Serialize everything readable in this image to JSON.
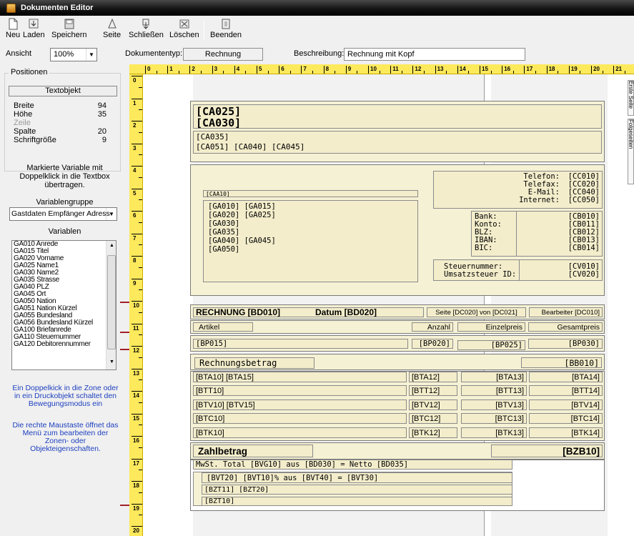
{
  "window": {
    "title": "Dokumenten Editor"
  },
  "toolbar": {
    "neu": "Neu",
    "laden": "Laden",
    "speichern": "Speichern",
    "seite": "Seite",
    "schliessen": "Schließen",
    "loeschen": "Löschen",
    "beenden": "Beenden"
  },
  "options": {
    "ansicht_label": "Ansicht",
    "zoom": "100%",
    "doctype_label": "Dokumententyp:",
    "doctype": "Rechnung",
    "beschreibung_label": "Beschreibung:",
    "beschreibung": "Rechnung mit Kopf"
  },
  "left_panel": {
    "positions_title": "Positionen",
    "object_type": "Textobjekt",
    "props": [
      {
        "label": "Breite",
        "value": "94"
      },
      {
        "label": "Höhe",
        "value": "35"
      },
      {
        "label": "Zeile",
        "value": ""
      },
      {
        "label": "Spalte",
        "value": "20"
      },
      {
        "label": "Schriftgröße",
        "value": "9"
      }
    ],
    "hint1": [
      "Markierte Variable mit",
      "Doppelklick in die Textbox",
      "übertragen."
    ],
    "group_label": "Variablengruppe",
    "group_value": "Gastdaten Empfänger Adress",
    "vars_label": "Variablen",
    "variables": [
      "GA010 Anrede",
      "GA015 Titel",
      "GA020 Vorname",
      "GA025 Name1",
      "GA030 Name2",
      "GA035 Strasse",
      "GA040 PLZ",
      "GA045 Ort",
      "GA050 Nation",
      "GA051 Nation Kürzel",
      "GA055 Bundesland",
      "GA056 Bundesland Kürzel",
      "GA100 Briefanrede",
      "GA110 Steuernummer",
      "GA120 Debitorennummer"
    ],
    "hint2": [
      "Ein Doppelkick in die Zone oder",
      "in ein Druckobjekt schaltet den",
      "Bewegungsmodus ein"
    ],
    "hint3": [
      "Die rechte Maustaste öffnet das",
      "Menü zum bearbeiten der",
      "Zonen- oder",
      "Objekteigenschaften."
    ]
  },
  "ruler": {
    "top": [
      "0",
      "1",
      "2",
      "3",
      "4",
      "5",
      "6",
      "7",
      "8",
      "9",
      "10",
      "11",
      "12",
      "13",
      "14",
      "15",
      "16",
      "17",
      "18",
      "19",
      "20",
      "21"
    ],
    "left": [
      "0",
      "1",
      "2",
      "3",
      "4",
      "5",
      "6",
      "7",
      "8",
      "9",
      "10",
      "11",
      "12",
      "13",
      "14",
      "15",
      "16",
      "17",
      "18",
      "19",
      "20"
    ]
  },
  "side_tabs": [
    "Erste Seite",
    "Folgeseiten"
  ],
  "doc": {
    "h1": "[CA025]",
    "h2": "[CA030]",
    "h3": "[CA035]",
    "h4": "[CA051] [CA040] [CA045]",
    "contact_labels": "Telefon:\nTelefax:\nE-Mail:\nInternet:",
    "contact_vals": "[CC010]\n[CC020]\n[CC040]\n[CC050]",
    "bank_labels": "Bank:\nKonto:\nBLZ:\nIBAN:\nBIC:",
    "bank_vals": "[CB010]\n[CB011]\n[CB012]\n[CB013]\n[CB014]",
    "tax_labels": "Steuernummer:\nUmsatzsteuer ID:",
    "tax_vals": "[CV010]\n[CV020]",
    "addr_head": "[CAA10]",
    "addr_lines": "[GA010] [GA015]\n[GA020] [GA025]\n[GA030]\n[GA035]\n[GA040] [GA045]\n[GA050]",
    "rechnung": "RECHNUNG [BD010]",
    "datum": "Datum [BD020]",
    "seite": "Seite [DC020] von [DC021]",
    "bearbeiter": "Bearbeiter [DC010]",
    "col_artikel": "Artikel",
    "col_anzahl": "Anzahl",
    "col_einzel": "Einzelpreis",
    "col_gesamt": "Gesamtpreis",
    "bp015": "[BP015]",
    "bp020": "[BP020]",
    "bp025": "[BP025]",
    "bp030": "[BP030]",
    "rb_label": "Rechnungsbetrag",
    "rb_val": "[BB010]",
    "rows": [
      [
        "[BTA10] [BTA15]",
        "[BTA12]",
        "[BTA13]",
        "[BTA14]"
      ],
      [
        "[BTT10]",
        "[BTT12]",
        "[BTT13]",
        "[BTT14]"
      ],
      [
        "[BTV10] [BTV15]",
        "[BTV12]",
        "[BTV13]",
        "[BTV14]"
      ],
      [
        "[BTC10]",
        "[BTC12]",
        "[BTC13]",
        "[BTC14]"
      ],
      [
        "[BTK10]",
        "[BTK12]",
        "[BTK13]",
        "[BTK14]"
      ]
    ],
    "zahl_label": "Zahlbetrag",
    "zahl_val": "[BZB10]",
    "mwst": "MwSt. Total [BVG10] aus [BD030] = Netto [BD035]",
    "bvt": "[BVT20] [BVT10]% aus [BVT40] = [BVT30]",
    "bzt11": "[BZT11] [BZT20]",
    "bzt10": "[BZT10]"
  }
}
